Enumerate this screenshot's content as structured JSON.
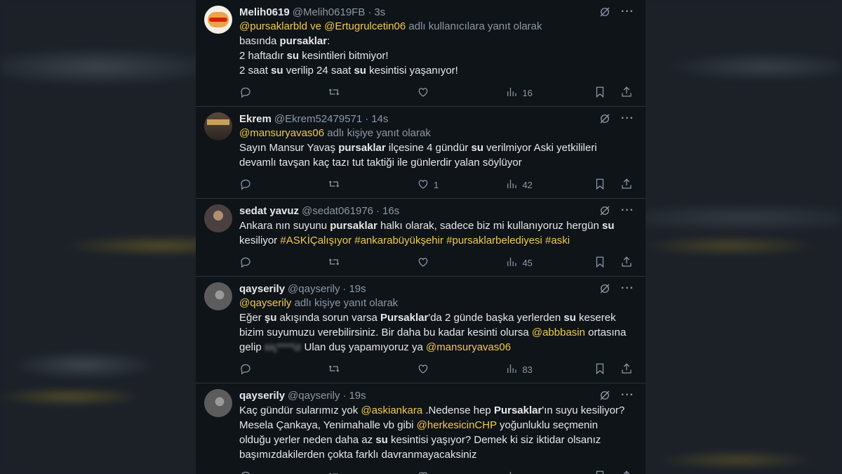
{
  "tweets": [
    {
      "name": "Melih0619",
      "handle": "@Melih0619FB",
      "time": "3s",
      "reply_to": {
        "mentions": "@pursaklarbld ve @Ertugrulcetin06",
        "suffix": " adlı kullanıcılara yanıt olarak"
      },
      "lines": [
        [
          {
            "t": "basında "
          },
          {
            "t": "pursaklar",
            "b": true
          },
          {
            "t": ":"
          }
        ],
        [
          {
            "t": "2 haftadır "
          },
          {
            "t": "su",
            "b": true
          },
          {
            "t": " kesintileri bitmiyor!"
          }
        ],
        [
          {
            "t": "2 saat "
          },
          {
            "t": "su",
            "b": true
          },
          {
            "t": " verilip 24 saat "
          },
          {
            "t": "su",
            "b": true
          },
          {
            "t": " kesintisi yaşanıyor!"
          }
        ]
      ],
      "likes": "",
      "views": "16",
      "avatar": "burger-king"
    },
    {
      "name": "Ekrem",
      "handle": "@Ekrem52479571",
      "time": "14s",
      "reply_to": {
        "mentions": "@mansuryavas06",
        "suffix": " adlı kişiye yanıt olarak"
      },
      "lines": [
        [
          {
            "t": "Sayın Mansur Yavaş "
          },
          {
            "t": "pursaklar",
            "b": true
          },
          {
            "t": " ilçesine 4 gündür "
          },
          {
            "t": "su",
            "b": true
          },
          {
            "t": " verilmiyor Aski yetkilileri"
          }
        ],
        [
          {
            "t": "devamlı tavşan kaç tazı tut taktiği ile günlerdir yalan söylüyor"
          }
        ]
      ],
      "likes": "1",
      "views": "42",
      "avatar": "ekrem"
    },
    {
      "name": "sedat yavuz",
      "handle": "@sedat061976",
      "time": "16s",
      "reply_to": null,
      "lines": [
        [
          {
            "t": "Ankara nın suyunu "
          },
          {
            "t": "pursaklar",
            "b": true
          },
          {
            "t": " halkı olarak, sadece biz mi kullanıyoruz hergün "
          },
          {
            "t": "su",
            "b": true
          }
        ],
        [
          {
            "t": "kesiliyor "
          },
          {
            "t": "#ASKİÇalışıyor #ankarabüyükşehir #pursaklarbelediyesi #aski",
            "m": true
          }
        ]
      ],
      "likes": "",
      "views": "45",
      "avatar": "sedat"
    },
    {
      "name": "qayserily",
      "handle": "@qayserily",
      "time": "19s",
      "reply_to": {
        "mentions": "@qayserily",
        "suffix": " adlı kişiye yanıt olarak"
      },
      "lines": [
        [
          {
            "t": "Eğer "
          },
          {
            "t": "şu",
            "b": true
          },
          {
            "t": " akışında sorun varsa "
          },
          {
            "t": "Pursaklar",
            "b": true
          },
          {
            "t": "'da 2 günde başka yerlerden "
          },
          {
            "t": "su",
            "b": true
          },
          {
            "t": " keserek"
          }
        ],
        [
          {
            "t": "bizim suyumuzu verebilirsiniz. Bir daha bu kadar kesinti olursa "
          },
          {
            "t": "@abbbasin",
            "m": true
          },
          {
            "t": " ortasına"
          }
        ],
        [
          {
            "t": "gelip "
          },
          {
            "t": "siç****iz",
            "x": true
          },
          {
            "t": " Ulan duş yapamıyoruz ya "
          },
          {
            "t": "@mansuryavas06",
            "m": true
          }
        ]
      ],
      "likes": "",
      "views": "83",
      "avatar": "qayserily"
    },
    {
      "name": "qayserily",
      "handle": "@qayserily",
      "time": "19s",
      "reply_to": null,
      "lines": [
        [
          {
            "t": "Kaç gündür sularımız yok "
          },
          {
            "t": "@askiankara",
            "m": true
          },
          {
            "t": " .Nedense hep "
          },
          {
            "t": "Pursaklar",
            "b": true
          },
          {
            "t": "'ın suyu kesiliyor?"
          }
        ],
        [
          {
            "t": "Mesela Çankaya, Yenimahalle vb gibi "
          },
          {
            "t": "@herkesicinCHP",
            "m": true
          },
          {
            "t": " yoğunluklu seçmenin"
          }
        ],
        [
          {
            "t": "olduğu yerler neden daha az "
          },
          {
            "t": "su",
            "b": true
          },
          {
            "t": " kesintisi yaşıyor? Demek ki siz iktidar olsanız"
          }
        ],
        [
          {
            "t": "başımızdakilerden çokta farklı davranmayacaksiniz"
          }
        ]
      ],
      "likes": "",
      "views": "",
      "avatar": "qayserily"
    }
  ],
  "colors": {
    "mention": "#f2c94c",
    "bg": "#0f1419",
    "text": "#e7e9ea",
    "muted": "#8b98a5"
  },
  "icons": [
    "reply-icon",
    "retweet-icon",
    "like-icon",
    "views-icon",
    "bookmark-icon",
    "share-icon",
    "grok-icon",
    "more-icon"
  ]
}
